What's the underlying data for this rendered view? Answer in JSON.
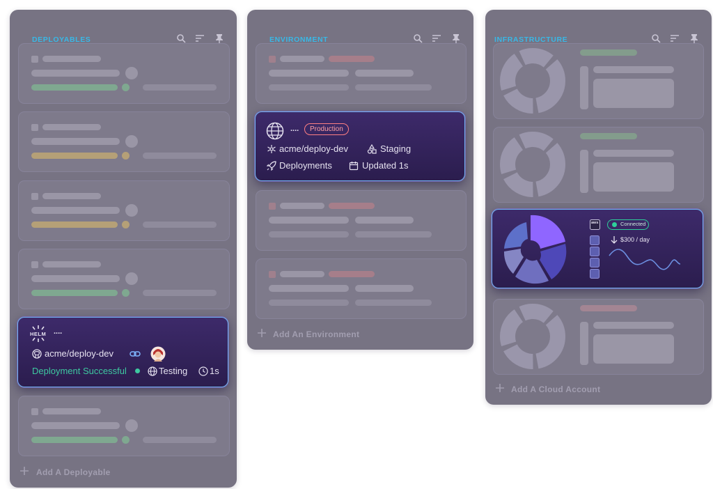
{
  "columns": {
    "deployables": {
      "title": "DEPLOYABLES",
      "add_label": "Add A Deployable",
      "active_card": {
        "logo_text": "HELM",
        "name": "....",
        "repo": "acme/deploy-dev",
        "status": "Deployment Successful",
        "environment": "Testing",
        "time": "1s"
      }
    },
    "environment": {
      "title": "ENVIRONMENT",
      "add_label": "Add An Environment",
      "active_card": {
        "name": "....",
        "badge": "Production",
        "repo": "acme/deploy-dev",
        "stage": "Staging",
        "deployments": "Deployments",
        "updated": "Updated 1s"
      }
    },
    "infrastructure": {
      "title": "INFRASTRUCTURE",
      "add_label": "Add A Cloud Account",
      "active_card": {
        "provider": "aws",
        "status": "Connected",
        "cost": "$300 / day"
      }
    }
  },
  "colors": {
    "accent_title": "#39b8e6",
    "active_border": "#73b6f0",
    "success_green": "#3ec9a0",
    "production_red": "#ff7f83",
    "connected_green": "#2ecf9a"
  }
}
